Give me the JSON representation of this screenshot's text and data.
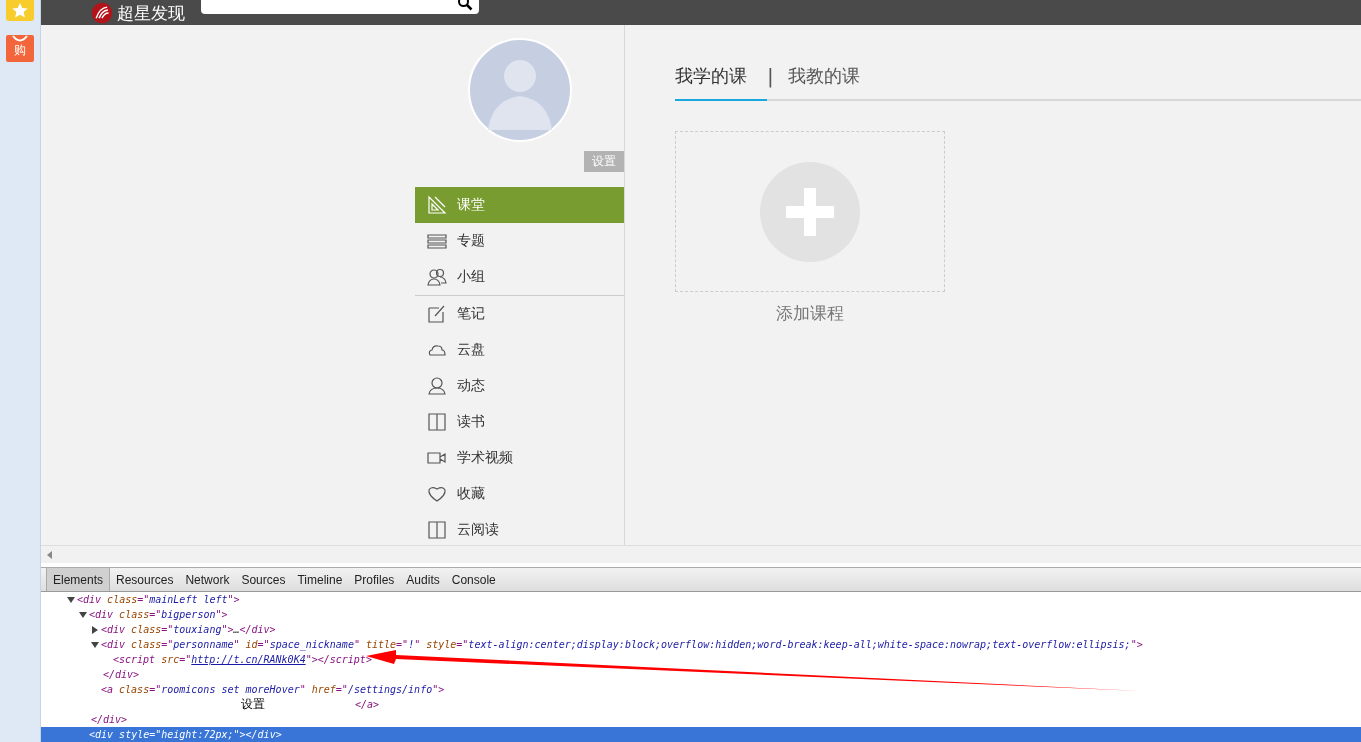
{
  "sidebar_strip": {
    "items": [
      {
        "kind": "star"
      },
      {
        "kind": "shop",
        "label": "购"
      }
    ]
  },
  "header": {
    "logo_text": "超星发现"
  },
  "profile": {
    "settings_button": "设置"
  },
  "nav": {
    "items": [
      {
        "label": "课堂",
        "selected": true
      },
      {
        "label": "专题",
        "selected": false
      },
      {
        "label": "小组",
        "selected": false
      },
      {
        "label": "笔记",
        "selected": false
      },
      {
        "label": "云盘",
        "selected": false
      },
      {
        "label": "动态",
        "selected": false
      },
      {
        "label": "读书",
        "selected": false
      },
      {
        "label": "学术视频",
        "selected": false
      },
      {
        "label": "收藏",
        "selected": false
      },
      {
        "label": "云阅读",
        "selected": false
      }
    ]
  },
  "course_tabs": [
    {
      "label": "我学的课",
      "selected": true
    },
    {
      "label": "我教的课",
      "selected": false
    }
  ],
  "tab_separator": "|",
  "add_course": {
    "label": "添加课程"
  },
  "devtools": {
    "tabs": [
      {
        "label": "Elements",
        "selected": true
      },
      {
        "label": "Resources",
        "selected": false
      },
      {
        "label": "Network",
        "selected": false
      },
      {
        "label": "Sources",
        "selected": false
      },
      {
        "label": "Timeline",
        "selected": false
      },
      {
        "label": "Profiles",
        "selected": false
      },
      {
        "label": "Audits",
        "selected": false
      },
      {
        "label": "Console",
        "selected": false
      }
    ],
    "tree": [
      {
        "expanded": true,
        "selected": false,
        "tokens": [
          {
            "kind": "tag",
            "text": "<div "
          },
          {
            "kind": "attr",
            "text": "class"
          },
          {
            "kind": "tag",
            "text": "=\""
          },
          {
            "kind": "value",
            "text": "mainLeft left"
          },
          {
            "kind": "tag",
            "text": "\">"
          }
        ],
        "children": [
          {
            "expanded": true,
            "selected": false,
            "tokens": [
              {
                "kind": "tag",
                "text": "<div "
              },
              {
                "kind": "attr",
                "text": "class"
              },
              {
                "kind": "tag",
                "text": "=\""
              },
              {
                "kind": "value",
                "text": "bigperson"
              },
              {
                "kind": "tag",
                "text": "\">"
              }
            ],
            "close": "</div>",
            "children": [
              {
                "expanded": false,
                "selected": false,
                "tokens": [
                  {
                    "kind": "tag",
                    "text": "<div "
                  },
                  {
                    "kind": "attr",
                    "text": "class"
                  },
                  {
                    "kind": "tag",
                    "text": "=\""
                  },
                  {
                    "kind": "value",
                    "text": "touxiang"
                  },
                  {
                    "kind": "tag",
                    "text": "\">"
                  },
                  {
                    "kind": "text",
                    "text": "…"
                  },
                  {
                    "kind": "tag",
                    "text": "</div>"
                  }
                ]
              },
              {
                "expanded": true,
                "selected": false,
                "tokens": [
                  {
                    "kind": "tag",
                    "text": "<div "
                  },
                  {
                    "kind": "attr",
                    "text": "class"
                  },
                  {
                    "kind": "tag",
                    "text": "=\""
                  },
                  {
                    "kind": "value",
                    "text": "personname"
                  },
                  {
                    "kind": "tag",
                    "text": "\" "
                  },
                  {
                    "kind": "attr",
                    "text": "id"
                  },
                  {
                    "kind": "tag",
                    "text": "=\""
                  },
                  {
                    "kind": "value",
                    "text": "space_nickname"
                  },
                  {
                    "kind": "tag",
                    "text": "\" "
                  },
                  {
                    "kind": "attr",
                    "text": "title"
                  },
                  {
                    "kind": "tag",
                    "text": "=\""
                  },
                  {
                    "kind": "value",
                    "text": "!"
                  },
                  {
                    "kind": "tag",
                    "text": "\" "
                  },
                  {
                    "kind": "attr",
                    "text": "style"
                  },
                  {
                    "kind": "tag",
                    "text": "=\""
                  },
                  {
                    "kind": "value",
                    "text": "text-align:center;display:block;overflow:hidden;word-break:keep-all;white-space:nowrap;text-overflow:ellipsis;"
                  },
                  {
                    "kind": "tag",
                    "text": "\">"
                  }
                ],
                "close": "</div>",
                "children": [
                  {
                    "selected": false,
                    "tokens": [
                      {
                        "kind": "tag",
                        "text": "<script "
                      },
                      {
                        "kind": "attr",
                        "text": "src"
                      },
                      {
                        "kind": "tag",
                        "text": "=\""
                      },
                      {
                        "kind": "link",
                        "text": "http://t.cn/RANk0K4"
                      },
                      {
                        "kind": "tag",
                        "text": "\"></script>"
                      }
                    ]
                  }
                ]
              },
              {
                "selected": false,
                "tokens": [
                  {
                    "kind": "tag",
                    "text": "<a "
                  },
                  {
                    "kind": "attr",
                    "text": "class"
                  },
                  {
                    "kind": "tag",
                    "text": "=\""
                  },
                  {
                    "kind": "value",
                    "text": "roomicons set moreHover"
                  },
                  {
                    "kind": "tag",
                    "text": "\" "
                  },
                  {
                    "kind": "attr",
                    "text": "href"
                  },
                  {
                    "kind": "tag",
                    "text": "=\""
                  },
                  {
                    "kind": "value",
                    "text": "/settings/info"
                  },
                  {
                    "kind": "tag",
                    "text": "\">"
                  }
                ],
                "inner_text": "设置",
                "close": "</a>"
              }
            ]
          },
          {
            "selected": true,
            "tokens": [
              {
                "kind": "tag",
                "text": "<div "
              },
              {
                "kind": "attr",
                "text": "style"
              },
              {
                "kind": "tag",
                "text": "=\""
              },
              {
                "kind": "value",
                "text": "height:72px;"
              },
              {
                "kind": "tag",
                "text": "\"></div>"
              }
            ]
          }
        ]
      }
    ]
  }
}
